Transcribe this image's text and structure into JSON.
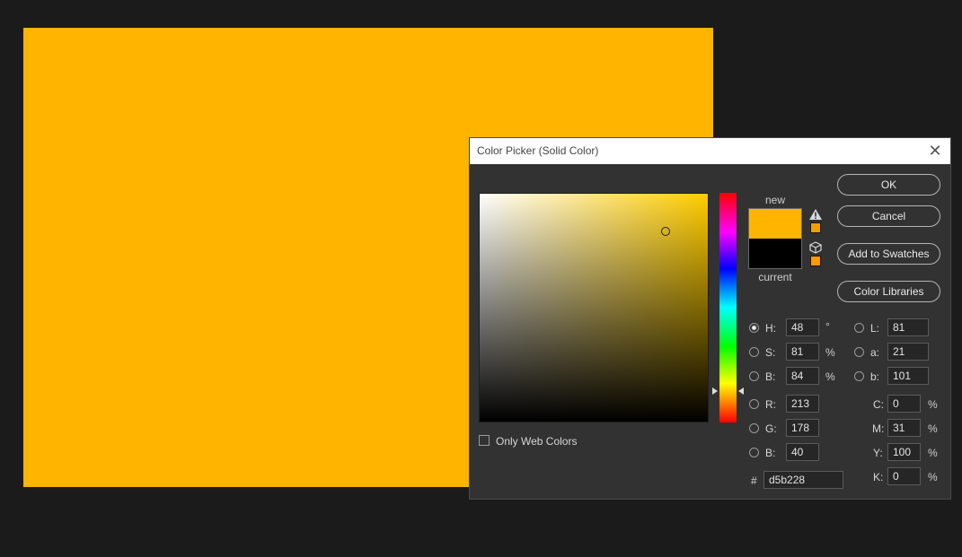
{
  "document": {
    "fill_color": "#ffb400"
  },
  "dialog": {
    "title": "Color Picker (Solid Color)",
    "close_glyph": "✕",
    "swatch_new_label": "new",
    "swatch_current_label": "current",
    "new_color": "#ffb400",
    "current_color": "#000000",
    "gamut_warning_color": "#f0a000",
    "web_safe_color": "#ff9900",
    "buttons": {
      "ok": "OK",
      "cancel": "Cancel",
      "add_to_swatches": "Add to Swatches",
      "color_libraries": "Color Libraries"
    },
    "hsb": [
      {
        "label": "H:",
        "value": "48",
        "unit": "°",
        "selected": true
      },
      {
        "label": "S:",
        "value": "81",
        "unit": "%",
        "selected": false
      },
      {
        "label": "B:",
        "value": "84",
        "unit": "%",
        "selected": false
      }
    ],
    "rgb": [
      {
        "label": "R:",
        "value": "213"
      },
      {
        "label": "G:",
        "value": "178"
      },
      {
        "label": "B:",
        "value": "40"
      }
    ],
    "lab": [
      {
        "label": "L:",
        "value": "81"
      },
      {
        "label": "a:",
        "value": "21"
      },
      {
        "label": "b:",
        "value": "101"
      }
    ],
    "cmyk": [
      {
        "label": "C:",
        "value": "0",
        "unit": "%"
      },
      {
        "label": "M:",
        "value": "31",
        "unit": "%"
      },
      {
        "label": "Y:",
        "value": "100",
        "unit": "%"
      },
      {
        "label": "K:",
        "value": "0",
        "unit": "%"
      }
    ],
    "hex": {
      "label": "#",
      "value": "d5b228"
    },
    "only_web_colors": {
      "label": "Only Web Colors",
      "checked": false
    }
  }
}
